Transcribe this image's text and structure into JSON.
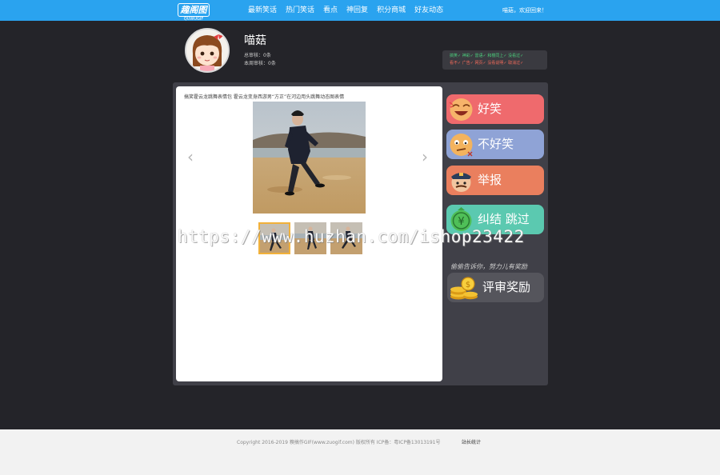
{
  "header": {
    "logo_text": "趣阁图",
    "logo_sub": "QUWUGIF",
    "nav": [
      "最新笑话",
      "热门笑话",
      "看点",
      "神回复",
      "积分商城",
      "好友动态"
    ],
    "welcome": "喵菇，欢迎回来！"
  },
  "profile": {
    "username": "喵菇",
    "stat_total": "总审核：0条",
    "stat_week": "本周审核：0条",
    "legend_good": "搞笑✓  神彩✓  雷语✓  和楼同上✓  没看过✓",
    "legend_bad": "看不✓  广告✓  网页✓  没看说明✓  取消过✓"
  },
  "post": {
    "caption": "搞笑霍云龙跳舞表情包 霍云龙变身西游男“方正”在河边用头跳舞动态图表情",
    "prev_arrow": "‹",
    "next_arrow": "›"
  },
  "votes": {
    "funny": "好笑",
    "not_funny": "不好笑",
    "report": "举报",
    "skip": "纠结 跳过",
    "reward_hint": "偷偷告诉你，努力儿有奖励",
    "reward": "评审奖励"
  },
  "watermark": "https://www.huzhan.com/ishop23422",
  "footer": {
    "copyright": "Copyright 2016-2019 糗搞作GIF(www.zuogif.com) 版权所有    ICP备：粤ICP备13013191号",
    "stats_link": "站长统计"
  },
  "colors": {
    "topbar": "#2aa3ef",
    "funny": "#ef6a6d",
    "not_funny": "#8fa3d6",
    "report": "#ea7f5e",
    "skip": "#5bc9b0",
    "thumb_active": "#f2b13a"
  },
  "icons": {
    "avatar": "cartoon-girl-avatar",
    "funny": "laughing-face-icon",
    "not_funny": "bored-face-icon",
    "report": "police-officer-icon",
    "skip": "money-bag-icon",
    "reward": "gold-coins-icon"
  }
}
